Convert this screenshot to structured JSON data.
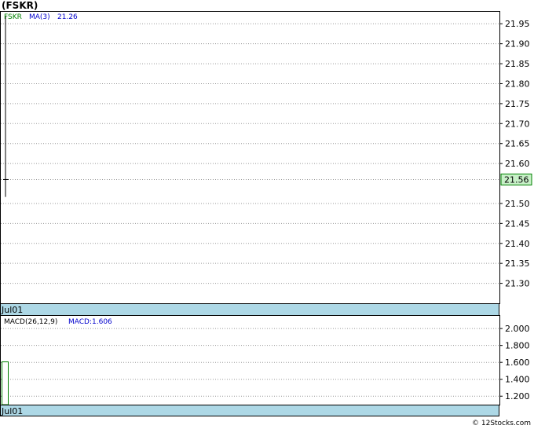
{
  "title": "(FSKR)",
  "credit": "© 12Stocks.com",
  "chart_data": [
    {
      "type": "line",
      "panel": "price",
      "series": [
        {
          "name": "FSKR",
          "x": [
            "Jul01"
          ],
          "high": [
            21.97
          ],
          "low": [
            21.54
          ],
          "close": [
            21.56
          ]
        },
        {
          "name": "MA(3)",
          "value": 21.26
        }
      ],
      "legend": [
        "FSKR",
        "MA(3)",
        "21.26"
      ],
      "ylim": [
        21.25,
        21.98
      ],
      "yticks": [
        "21.95",
        "21.90",
        "21.85",
        "21.80",
        "21.75",
        "21.70",
        "21.65",
        "21.60",
        "21.50",
        "21.45",
        "21.40",
        "21.35",
        "21.30"
      ],
      "last_price_label": "21.56",
      "last_price": 21.56,
      "x_label": "Jul01",
      "colors": {
        "fskr": "#008000",
        "ma": "#0000cc",
        "last_price_bg": "#c8f0c8",
        "axis_band": "#add8e6"
      },
      "grid": true
    },
    {
      "type": "bar",
      "panel": "macd",
      "legend": [
        "MACD(26,12,9)",
        "MACD:1.606"
      ],
      "categories": [
        "Jul01"
      ],
      "values": [
        1.606
      ],
      "ylim": [
        1.1,
        2.15
      ],
      "yticks": [
        "2.000",
        "1.800",
        "1.600",
        "1.400",
        "1.200"
      ],
      "x_label": "Jul01",
      "colors": {
        "bar": "#008000",
        "macd_text": "#0000cc"
      },
      "grid": true
    }
  ]
}
